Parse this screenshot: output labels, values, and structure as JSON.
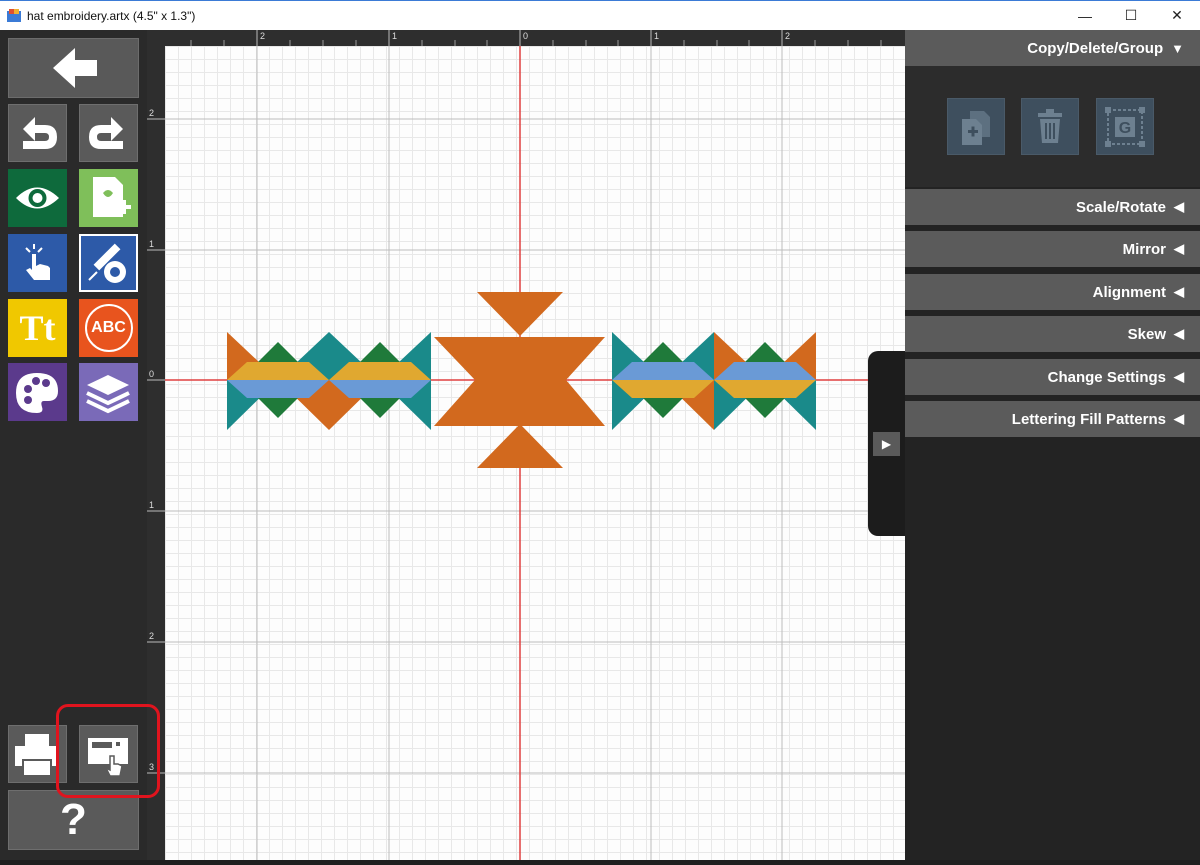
{
  "window": {
    "title": "hat embroidery.artx (4.5\" x 1.3\")",
    "minimize_glyph": "—",
    "maximize_glyph": "☐",
    "close_glyph": "✕"
  },
  "toolbar": {
    "back_icon": "back-arrow-icon",
    "tools": [
      {
        "name": "undo-icon"
      },
      {
        "name": "redo-icon"
      },
      {
        "name": "view-eye-icon"
      },
      {
        "name": "add-design-icon"
      },
      {
        "name": "select-hand-icon"
      },
      {
        "name": "edit-tools-icon"
      },
      {
        "name": "text-tt-icon"
      },
      {
        "name": "monogram-abc-icon"
      },
      {
        "name": "color-palette-icon"
      },
      {
        "name": "layers-icon"
      },
      {
        "name": "print-icon"
      },
      {
        "name": "send-to-machine-icon"
      },
      {
        "name": "help-icon"
      }
    ],
    "text_tool_label": "Tt",
    "monogram_label": "ABC",
    "help_label": "?"
  },
  "rulers": {
    "top_labels": [
      "2",
      "1",
      "0",
      "1",
      "2"
    ],
    "left_labels": [
      "2",
      "1",
      "0",
      "1",
      "2",
      "3"
    ]
  },
  "right_panel": {
    "sections": [
      {
        "label": "Copy/Delete/Group",
        "arrow": "▼",
        "expanded": true
      },
      {
        "label": "Scale/Rotate",
        "arrow": "◀"
      },
      {
        "label": "Mirror",
        "arrow": "◀"
      },
      {
        "label": "Alignment",
        "arrow": "◀"
      },
      {
        "label": "Skew",
        "arrow": "◀"
      },
      {
        "label": "Change Settings",
        "arrow": "◀"
      },
      {
        "label": "Lettering Fill Patterns",
        "arrow": "◀"
      }
    ],
    "copy_buttons": [
      {
        "name": "duplicate-icon"
      },
      {
        "name": "trash-icon"
      },
      {
        "name": "group-icon",
        "letter": "G"
      }
    ]
  },
  "panel_toggle_arrow": "▶",
  "colors": {
    "orange": "#d2691e",
    "teal": "#1a8a8a",
    "green": "#1f7a3a",
    "gold": "#e0a830",
    "blue": "#6a9ad6",
    "axis_red": "#e04040",
    "highlight_red": "#e0141e"
  }
}
